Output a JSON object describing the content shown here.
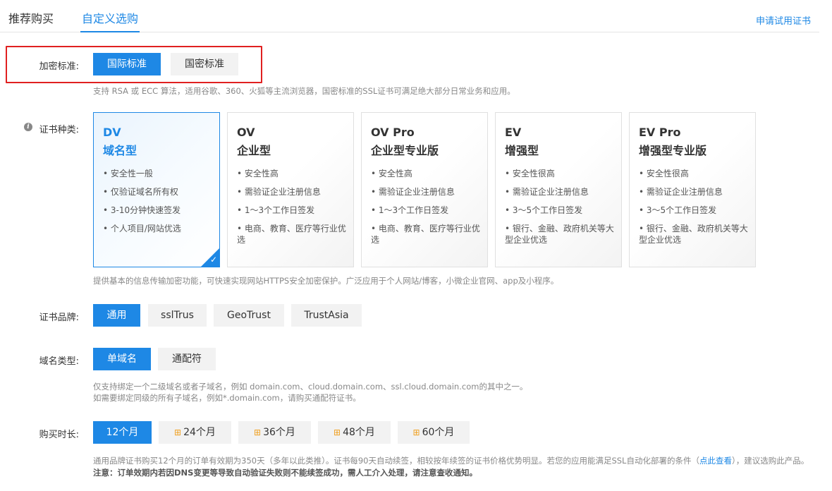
{
  "tabs": {
    "recommended": "推荐购买",
    "custom": "自定义选购"
  },
  "trial_link": "申请试用证书",
  "encryption": {
    "label": "加密标准:",
    "options": [
      "国际标准",
      "国密标准"
    ],
    "selected": "国际标准",
    "hint": "支持 RSA 或 ECC 算法，适用谷歌、360、火狐等主流浏览器，国密标准的SSL证书可满足绝大部分日常业务和应用。"
  },
  "cert_type": {
    "label": "证书种类:",
    "cards": [
      {
        "code": "DV",
        "name": "域名型",
        "features": [
          "• 安全性一般",
          "• 仅验证域名所有权",
          "• 3-10分钟快速签发",
          "• 个人项目/网站优选"
        ]
      },
      {
        "code": "OV",
        "name": "企业型",
        "features": [
          "• 安全性高",
          "• 需验证企业注册信息",
          "• 1～3个工作日签发",
          "• 电商、教育、医疗等行业优选"
        ]
      },
      {
        "code": "OV Pro",
        "name": "企业型专业版",
        "features": [
          "• 安全性高",
          "• 需验证企业注册信息",
          "• 1～3个工作日签发",
          "• 电商、教育、医疗等行业优选"
        ]
      },
      {
        "code": "EV",
        "name": "增强型",
        "features": [
          "• 安全性很高",
          "• 需验证企业注册信息",
          "• 3～5个工作日签发",
          "• 银行、金融、政府机关等大型企业优选"
        ]
      },
      {
        "code": "EV Pro",
        "name": "增强型专业版",
        "features": [
          "• 安全性很高",
          "• 需验证企业注册信息",
          "• 3～5个工作日签发",
          "• 银行、金融、政府机关等大型企业优选"
        ]
      }
    ],
    "selected": "DV",
    "hint": "提供基本的信息传输加密功能，可快速实现网站HTTPS安全加密保护。广泛应用于个人网站/博客，小微企业官网、app及小程序。"
  },
  "brand": {
    "label": "证书品牌:",
    "options": [
      "通用",
      "sslTrus",
      "GeoTrust",
      "TrustAsia"
    ],
    "selected": "通用"
  },
  "domain_type": {
    "label": "域名类型:",
    "options": [
      "单域名",
      "通配符"
    ],
    "selected": "单域名",
    "hint_line1": "仅支持绑定一个二级域名或者子域名，例如 domain.com、cloud.domain.com、ssl.cloud.domain.com的其中之一。",
    "hint_line2": "如需要绑定同级的所有子域名，例如*.domain.com，请购买通配符证书。"
  },
  "duration": {
    "label": "购买时长:",
    "options": [
      "12个月",
      "24个月",
      "36个月",
      "48个月",
      "60个月"
    ],
    "selected": "12个月",
    "gift_icon": "gift-icon"
  },
  "notice": {
    "part1": "通用品牌证书购买12个月的订单有效期为350天（多年以此类推）。证书每90天自动续签，相较按年续签的证书价格优势明显。若您的应用能满足SSL自动化部署的条件（",
    "link": "点此查看",
    "part2": "），建议选购此产品。",
    "bold": " 注意：订单效期内若因DNS变更等导致自动验证失败则不能续签成功，需人工介入处理，请注意查收通知。"
  },
  "colors": {
    "accent": "#1e88e5",
    "highlight": "#e02020",
    "gift": "#f0a020"
  }
}
